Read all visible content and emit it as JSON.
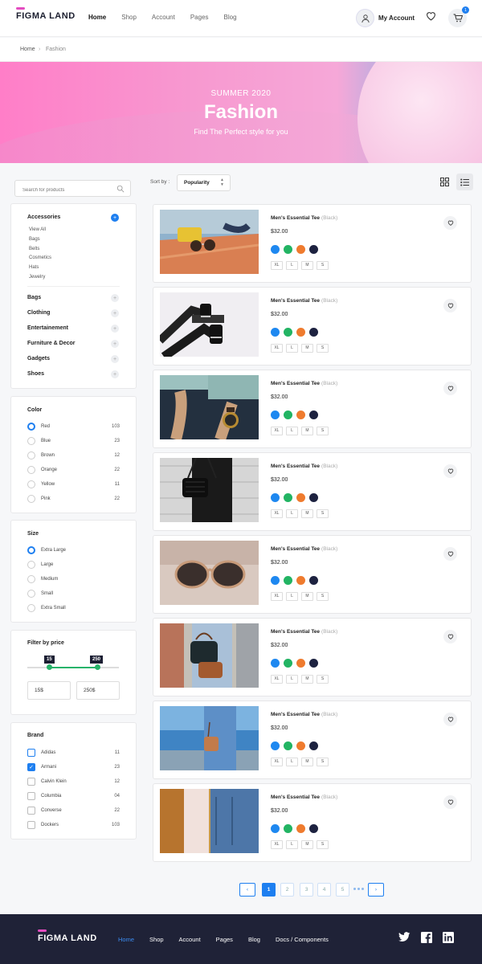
{
  "brand": {
    "name": "FIGMA LAND",
    "accent": "#e44cc0",
    "primary": "#1e7ff0"
  },
  "nav": {
    "items": [
      "Home",
      "Shop",
      "Account",
      "Pages",
      "Blog"
    ],
    "active": "Home"
  },
  "account": {
    "label": "My Account",
    "cart_count": "1"
  },
  "breadcrumb": {
    "home": "Home",
    "current": "Fashion"
  },
  "hero": {
    "eyebrow": "SUMMER 2020",
    "title": "Fashion",
    "tagline": "Find The Perfect style for you"
  },
  "search": {
    "placeholder": "Search for products"
  },
  "categories": {
    "accessories": {
      "label": "Accessories",
      "items": [
        "View All",
        "Bags",
        "Belts",
        "Cosmetics",
        "Hats",
        "Jewelry"
      ]
    },
    "others": [
      "Bags",
      "Clothing",
      "Entertainement",
      "Furniture & Decor",
      "Gadgets",
      "Shoes"
    ]
  },
  "color_filter": {
    "title": "Color",
    "options": [
      {
        "label": "Red",
        "count": "103",
        "selected": true
      },
      {
        "label": "Blue",
        "count": "23"
      },
      {
        "label": "Brown",
        "count": "12"
      },
      {
        "label": "Orange",
        "count": "22"
      },
      {
        "label": "Yellow",
        "count": "11"
      },
      {
        "label": "Pink",
        "count": "22"
      }
    ]
  },
  "size_filter": {
    "title": "Size",
    "options": [
      "Extra Large",
      "Large",
      "Medium",
      "Small",
      "Extra Small"
    ],
    "selected": "Extra Large"
  },
  "price_filter": {
    "title": "Filter by price",
    "min": "15",
    "max": "250",
    "min_input": "15$",
    "max_input": "250$"
  },
  "brand_filter": {
    "title": "Brand",
    "options": [
      {
        "label": "Adidas",
        "count": "11"
      },
      {
        "label": "Armani",
        "count": "23",
        "checked": true
      },
      {
        "label": "Calvin Klein",
        "count": "12"
      },
      {
        "label": "Columbia",
        "count": "04"
      },
      {
        "label": "Converse",
        "count": "22"
      },
      {
        "label": "Dockers",
        "count": "103"
      }
    ]
  },
  "toolbar": {
    "sort_label": "Sort by :",
    "sort_value": "Popularity",
    "view": "list"
  },
  "product_common": {
    "name": "Men's Essential Tee",
    "variant": "(Black)",
    "price": "$32.00",
    "colors": [
      "#1e88f0",
      "#22b463",
      "#ef7b2e",
      "#1d2240"
    ],
    "sizes": [
      "XL",
      "L",
      "M",
      "S"
    ]
  },
  "products": [
    {
      "image": "sunglasses-on-deck"
    },
    {
      "image": "legs-sneakers"
    },
    {
      "image": "wrist-watch"
    },
    {
      "image": "black-handbag"
    },
    {
      "image": "sunglasses-closeup"
    },
    {
      "image": "shoulder-bag-street"
    },
    {
      "image": "bag-seaside"
    },
    {
      "image": "jacket-rack"
    }
  ],
  "pagination": {
    "pages": [
      "1",
      "2",
      "3",
      "4",
      "5"
    ],
    "current": "1"
  },
  "footer": {
    "logo": "FIGMA LAND",
    "links": [
      "Home",
      "Shop",
      "Account",
      "Pages",
      "Blog",
      "Docs / Components"
    ],
    "active": "Home",
    "social": [
      "twitter-icon",
      "facebook-icon",
      "linkedin-icon"
    ]
  }
}
